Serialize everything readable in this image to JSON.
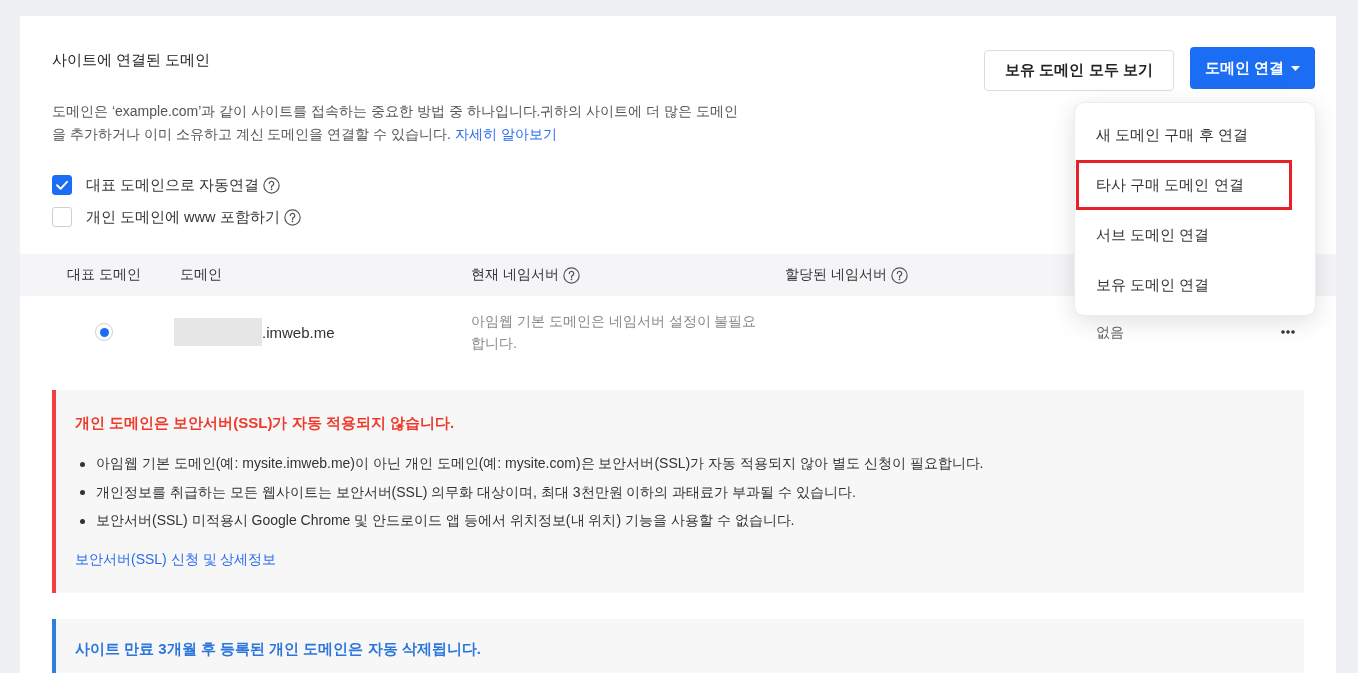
{
  "section": {
    "title": "사이트에 연결된 도메인",
    "description": "도메인은 ‘example.com’과 같이 사이트를 접속하는 중요한 방법 중 하나입니다.귀하의 사이트에 더 많은 도메인을 추가하거나 이미 소유하고 계신 도메인을 연결할 수 있습니다.",
    "learn_more_link": "자세히 알아보기"
  },
  "view_all_button": {
    "label": "보유 도메인 모두 보기"
  },
  "connect_button": {
    "label": "도메인 연결",
    "expanded": true
  },
  "dropdown_menu": {
    "items": [
      {
        "label": "새 도메인 구매 후 연결",
        "highlighted": false
      },
      {
        "label": "타사 구매 도메인 연결",
        "highlighted": true
      },
      {
        "label": "서브 도메인 연결",
        "highlighted": false
      },
      {
        "label": "보유 도메인 연결",
        "highlighted": false
      }
    ]
  },
  "options": [
    {
      "label": "대표 도메인으로 자동연결",
      "checked": true,
      "help": true
    },
    {
      "label": "개인 도메인에 www 포함하기",
      "checked": false,
      "help": true
    }
  ],
  "table": {
    "columns": [
      {
        "label": "대표 도메인",
        "help": false
      },
      {
        "label": "도메인",
        "help": false
      },
      {
        "label": "현재 네임서버",
        "help": true
      },
      {
        "label": "할당된 네임서버",
        "help": true
      }
    ],
    "rows": [
      {
        "selected": true,
        "redacted": true,
        "domain": ".imweb.me",
        "current_nameserver": "아임웹 기본 도메인은 네임서버 설정이 불필요합니다.",
        "column_5": "없음"
      }
    ]
  },
  "alerts": [
    {
      "kind": "warning",
      "title": "개인 도메인은 보안서버(SSL)가 자동 적용되지 않습니다.",
      "bullets": [
        "아임웹 기본 도메인(예: mysite.imweb.me)이 아닌 개인 도메인(예: mysite.com)은 보안서버(SSL)가 자동 적용되지 않아 별도 신청이 필요합니다.",
        "개인정보를 취급하는 모든 웹사이트는 보안서버(SSL) 의무화 대상이며, 최대 3천만원 이하의 과태료가 부과될 수 있습니다.",
        "보안서버(SSL) 미적용시 Google Chrome 및 안드로이드 앱 등에서 위치정보(내 위치) 기능을 사용할 수 없습니다."
      ],
      "link": "보안서버(SSL) 신청 및 상세정보"
    },
    {
      "kind": "info",
      "title": "사이트 만료 3개월 후 등록된 개인 도메인은 자동 삭제됩니다."
    }
  ]
}
